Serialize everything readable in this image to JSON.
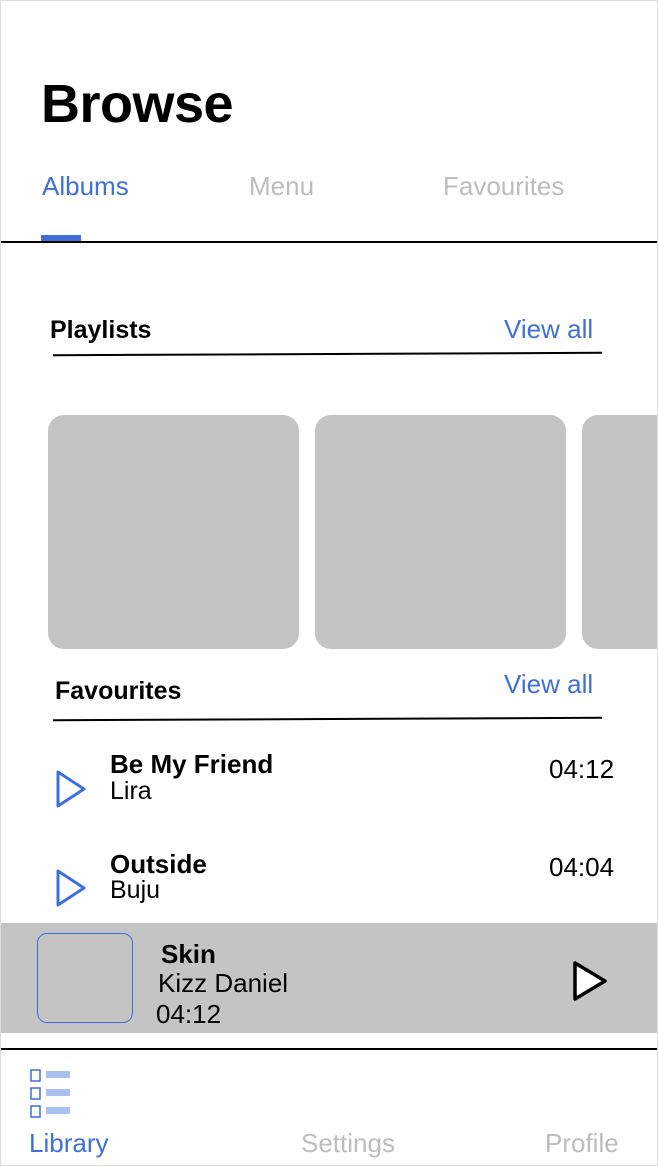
{
  "header": {
    "title": "Browse"
  },
  "tabs": [
    {
      "label": "Albums",
      "active": true
    },
    {
      "label": "Menu",
      "active": false
    },
    {
      "label": "Favourites",
      "active": false
    }
  ],
  "playlists": {
    "title": "Playlists",
    "view_all": "View all",
    "card_count_visible": 3
  },
  "favourites": {
    "title": "Favourites",
    "view_all": "View all",
    "songs": [
      {
        "title": "Be My Friend",
        "artist": "Lira",
        "duration": "04:12"
      },
      {
        "title": "Outside",
        "artist": "Buju",
        "duration": "04:04"
      }
    ]
  },
  "now_playing": {
    "title": "Skin",
    "artist": "Kizz Daniel",
    "time": "04:12"
  },
  "bottom_nav": [
    {
      "label": "Library",
      "icon": "library-list-icon",
      "active": true
    },
    {
      "label": "Settings",
      "active": false
    },
    {
      "label": "Profile",
      "active": false
    }
  ],
  "colors": {
    "accent": "#3f6fd8",
    "inactive": "#bdbdbd",
    "placeholder": "#c4c4c4"
  }
}
